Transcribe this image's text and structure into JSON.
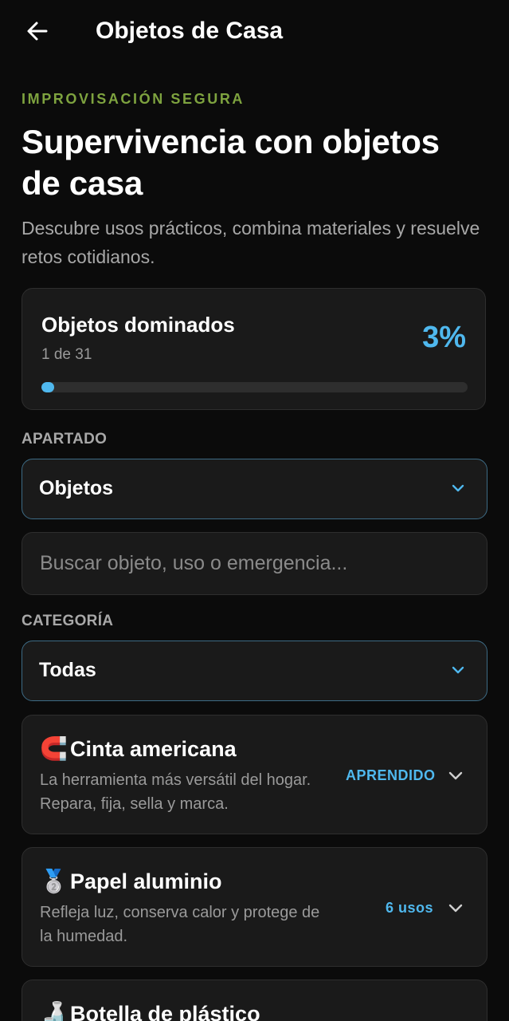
{
  "header": {
    "title": "Objetos de Casa",
    "back_icon": "arrow-left-icon"
  },
  "hero": {
    "eyebrow": "IMPROVISACIÓN SEGURA",
    "title": "Supervivencia con objetos de casa",
    "subtitle": "Descubre usos prácticos, combina materiales y resuelve retos cotidianos."
  },
  "progress": {
    "title": "Objetos dominados",
    "count_text": "1 de 31",
    "percent_text": "3%",
    "fraction": 0.03
  },
  "section": {
    "label": "APARTADO",
    "selected": "Objetos"
  },
  "search": {
    "placeholder": "Buscar objeto, uso o emergencia...",
    "value": ""
  },
  "category": {
    "label": "CATEGORÍA",
    "selected": "Todas"
  },
  "items": [
    {
      "emoji": "🧲",
      "icon": "magnet-icon",
      "name": "Cinta americana",
      "description": "La herramienta más versátil del hogar. Repara, fija, sella y marca.",
      "badge": "APRENDIDO"
    },
    {
      "emoji": "🥈",
      "icon": "silver-medal-icon",
      "name": "Papel aluminio",
      "description": "Refleja luz, conserva calor y protege de la humedad.",
      "badge": "6 usos"
    },
    {
      "emoji": "🍶",
      "icon": "bottle-icon",
      "name": "Botella de plástico",
      "description": "",
      "badge": ""
    }
  ],
  "colors": {
    "accent": "#4fb8ee",
    "eyebrow": "#7ea33f",
    "background": "#0b0b0b",
    "card": "#1a1a1a"
  }
}
